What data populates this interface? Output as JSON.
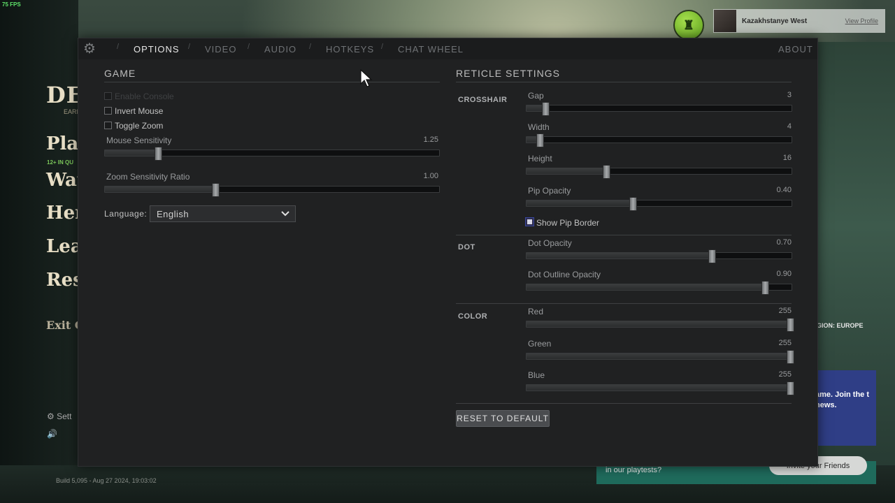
{
  "fps": "75 FPS",
  "background": {
    "logo": "DE",
    "early": "EARL",
    "play": "Play",
    "queue": "12+ IN QU",
    "watch": "Wat",
    "heroes": "Her",
    "learn": "Lear",
    "research": "Rese",
    "exit": "Exit G",
    "settings": "Sett",
    "build": "Build 5,095 - Aug 27 2024, 19:03:02",
    "region": "GION: EUROPE",
    "news": "ame. Join the t news.",
    "playtest": "in our playtests?",
    "invite": "Invite your Friends"
  },
  "profile": {
    "name": "Kazakhstanye West",
    "view_profile": "View Profile"
  },
  "tabs": {
    "options": "OPTIONS",
    "video": "VIDEO",
    "audio": "AUDIO",
    "hotkeys": "HOTKEYS",
    "chat_wheel": "CHAT WHEEL",
    "about": "ABOUT",
    "separator": "/"
  },
  "game": {
    "title": "GAME",
    "enable_console": "Enable Console",
    "invert_mouse": "Invert Mouse",
    "toggle_zoom": "Toggle Zoom",
    "mouse_sensitivity": {
      "label": "Mouse Sensitivity",
      "value": "1.25",
      "fraction": 0.16
    },
    "zoom_ratio": {
      "label": "Zoom Sensitivity Ratio",
      "value": "1.00",
      "fraction": 0.33
    },
    "language_label": "Language:",
    "language_value": "English"
  },
  "reticle": {
    "title": "RETICLE SETTINGS",
    "crosshair_head": "CROSSHAIR",
    "dot_head": "DOT",
    "color_head": "COLOR",
    "gap": {
      "label": "Gap",
      "value": "3",
      "fraction": 0.07
    },
    "width": {
      "label": "Width",
      "value": "4",
      "fraction": 0.05
    },
    "height": {
      "label": "Height",
      "value": "16",
      "fraction": 0.3
    },
    "pip_opacity": {
      "label": "Pip Opacity",
      "value": "0.40",
      "fraction": 0.4
    },
    "show_pip_border": "Show Pip Border",
    "dot_opacity": {
      "label": "Dot Opacity",
      "value": "0.70",
      "fraction": 0.7
    },
    "dot_outline_opacity": {
      "label": "Dot Outline Opacity",
      "value": "0.90",
      "fraction": 0.9
    },
    "red": {
      "label": "Red",
      "value": "255",
      "fraction": 1.0
    },
    "green": {
      "label": "Green",
      "value": "255",
      "fraction": 1.0
    },
    "blue": {
      "label": "Blue",
      "value": "255",
      "fraction": 1.0
    },
    "reset": "RESET TO DEFAULT"
  },
  "icons": {
    "gear": "gear-icon",
    "chevron": "chevron-down-icon",
    "cursor": "mouse-cursor-icon",
    "speaker": "speaker-icon",
    "profile_hat": "hat-icon"
  }
}
